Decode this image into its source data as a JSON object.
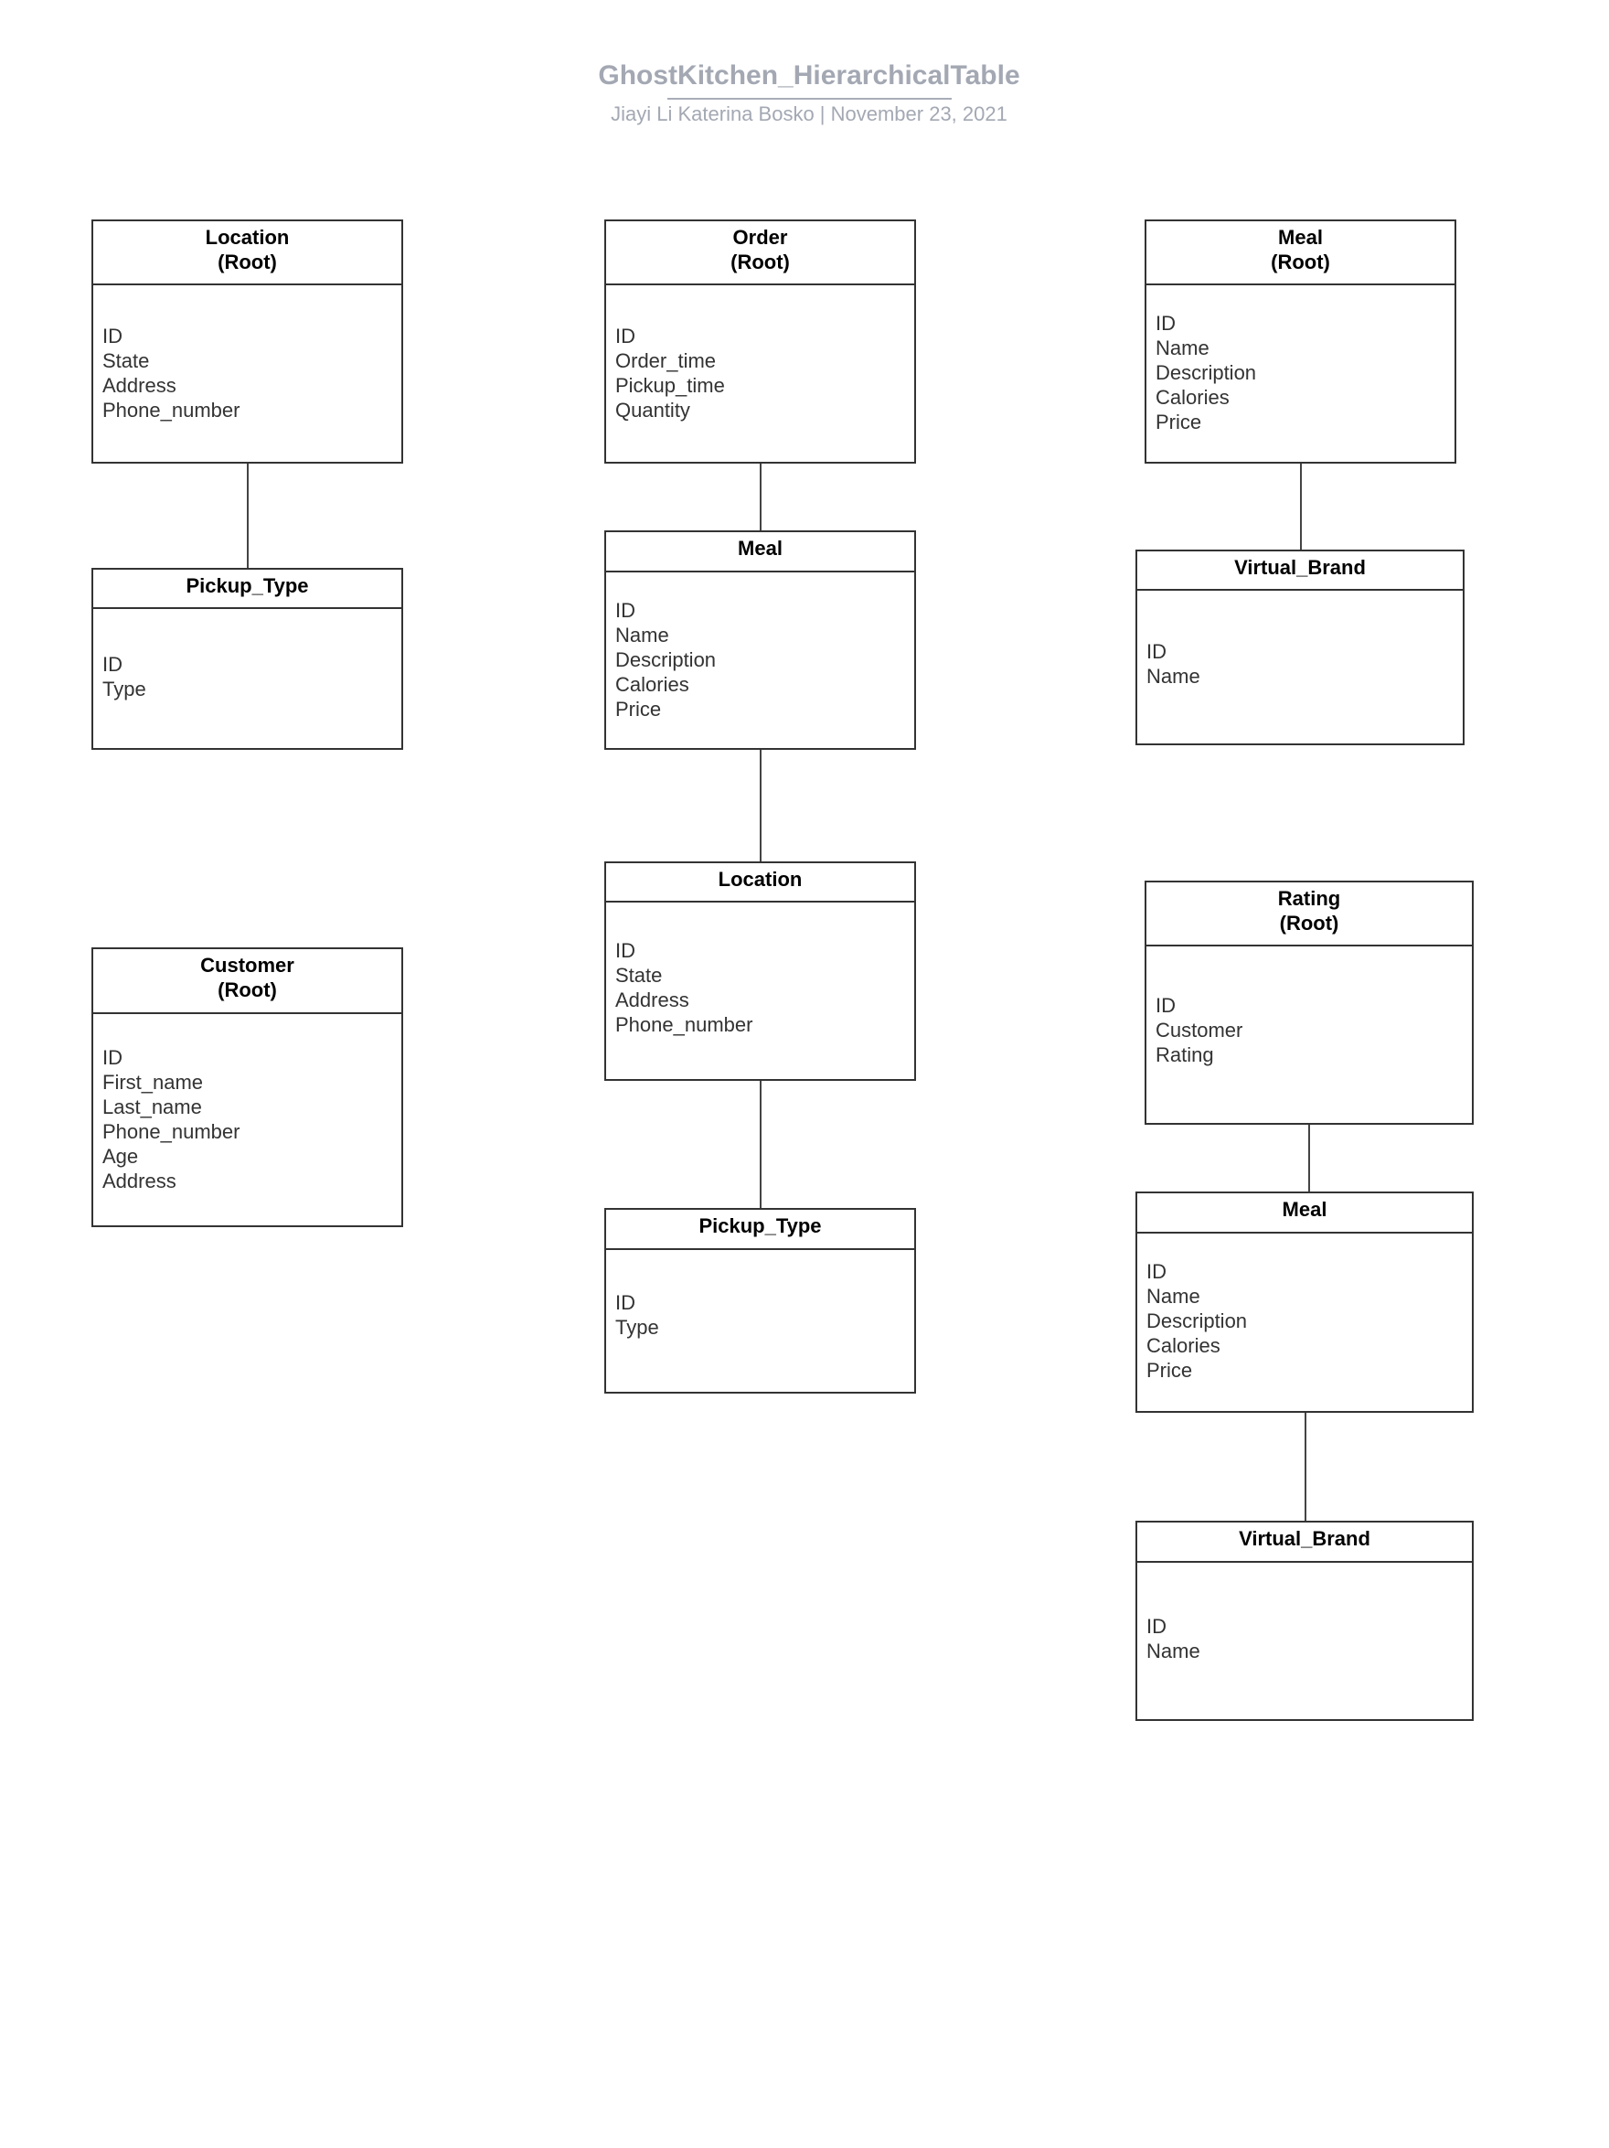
{
  "header": {
    "title": "GhostKitchen_HierarchicalTable",
    "subtitle": "Jiayi Li  Katerina Bosko |  November 23, 2021"
  },
  "entities": {
    "location_root": {
      "name": "Location",
      "tag": "(Root)",
      "fields": [
        "ID",
        "State",
        "Address",
        "Phone_number"
      ]
    },
    "pickup_type_left": {
      "name": "Pickup_Type",
      "tag": "",
      "fields": [
        "ID",
        "Type"
      ]
    },
    "customer_root": {
      "name": "Customer",
      "tag": "(Root)",
      "fields": [
        "ID",
        "First_name",
        "Last_name",
        "Phone_number",
        "Age",
        "Address"
      ]
    },
    "order_root": {
      "name": "Order",
      "tag": "(Root)",
      "fields": [
        "ID",
        "Order_time",
        "Pickup_time",
        "Quantity"
      ]
    },
    "order_meal": {
      "name": "Meal",
      "tag": "",
      "fields": [
        "ID",
        "Name",
        "Description",
        "Calories",
        "Price"
      ]
    },
    "order_location": {
      "name": "Location",
      "tag": "",
      "fields": [
        "ID",
        "State",
        "Address",
        "Phone_number"
      ]
    },
    "order_pickup_type": {
      "name": "Pickup_Type",
      "tag": "",
      "fields": [
        "ID",
        "Type"
      ]
    },
    "meal_root": {
      "name": "Meal",
      "tag": "(Root)",
      "fields": [
        "ID",
        "Name",
        "Description",
        "Calories",
        "Price"
      ]
    },
    "meal_virtual_brand": {
      "name": "Virtual_Brand",
      "tag": "",
      "fields": [
        "ID",
        "Name"
      ]
    },
    "rating_root": {
      "name": "Rating",
      "tag": "(Root)",
      "fields": [
        "ID",
        "Customer",
        "Rating"
      ]
    },
    "rating_meal": {
      "name": "Meal",
      "tag": "",
      "fields": [
        "ID",
        "Name",
        "Description",
        "Calories",
        "Price"
      ]
    },
    "rating_virtual_brand": {
      "name": "Virtual_Brand",
      "tag": "",
      "fields": [
        "ID",
        "Name"
      ]
    }
  },
  "relationships": [
    {
      "parent": "location_root",
      "child": "pickup_type_left"
    },
    {
      "parent": "order_root",
      "child": "order_meal"
    },
    {
      "parent": "order_meal",
      "child": "order_location"
    },
    {
      "parent": "order_location",
      "child": "order_pickup_type"
    },
    {
      "parent": "meal_root",
      "child": "meal_virtual_brand"
    },
    {
      "parent": "rating_root",
      "child": "rating_meal"
    },
    {
      "parent": "rating_meal",
      "child": "rating_virtual_brand"
    }
  ]
}
